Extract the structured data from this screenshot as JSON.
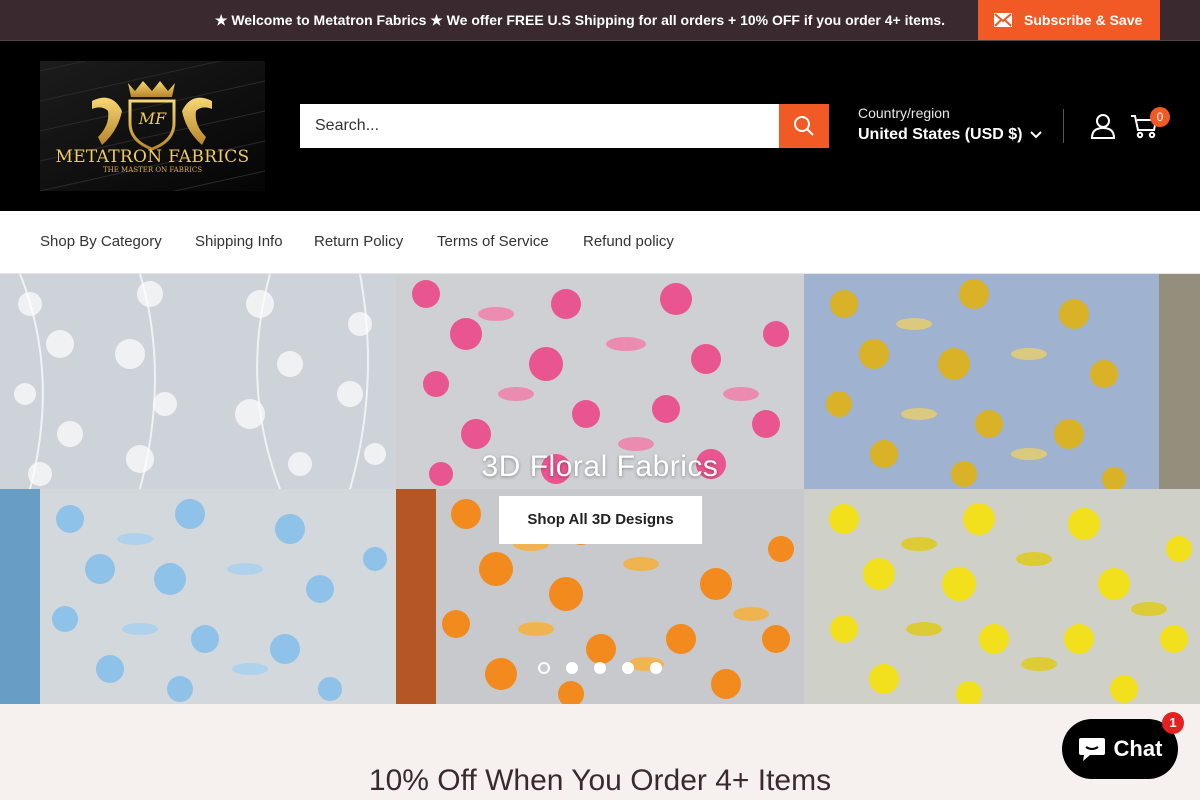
{
  "announcement": {
    "text": "★ Welcome to Metatron Fabrics ★ We offer FREE U.S Shipping for all orders + 10% OFF if you order 4+ items.",
    "subscribe_label": "Subscribe & Save"
  },
  "header": {
    "logo": {
      "monogram": "MF",
      "brand": "METATRON FABRICS",
      "tagline": "THE MASTER ON FABRICS"
    },
    "search_placeholder": "Search...",
    "country_label": "Country/region",
    "country_value": "United States (USD $)",
    "cart_count": "0"
  },
  "nav": {
    "items": [
      {
        "label": "Shop By Category"
      },
      {
        "label": "Shipping Info"
      },
      {
        "label": "Return Policy"
      },
      {
        "label": "Terms of Service"
      },
      {
        "label": "Refund policy"
      }
    ]
  },
  "hero": {
    "title": "3D Floral Fabrics",
    "button_label": "Shop All 3D Designs",
    "slide_count": 5,
    "active_slide": 1,
    "tile_colors": [
      "#e9ecef",
      "#e8558f",
      "#d9b227",
      "#8fc2e8",
      "#f28a1e",
      "#f3e01c"
    ]
  },
  "promo": {
    "title": "10% Off When You Order 4+ Items"
  },
  "chat": {
    "label": "Chat",
    "badge": "1"
  },
  "colors": {
    "accent": "#f15a24",
    "announcement_bg": "#3a2a30",
    "header_bg": "#000000",
    "page_bg": "#f6f1ee"
  }
}
